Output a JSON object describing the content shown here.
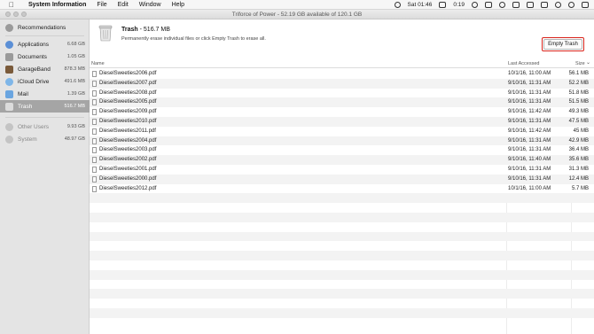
{
  "menubar": {
    "app_name": "System Information",
    "menus": [
      "File",
      "Edit",
      "Window",
      "Help"
    ],
    "clock": "Sat 01:46",
    "battery_time": "0:19"
  },
  "window": {
    "title": "Triforce of Power - 52.19 GB available of 120.1 GB"
  },
  "sidebar": {
    "recommendations": "Recommendations",
    "items": [
      {
        "label": "Applications",
        "size": "6.68 GB",
        "color": "#5b8fd6"
      },
      {
        "label": "Documents",
        "size": "1.05 GB",
        "color": "#9a9a9a"
      },
      {
        "label": "GarageBand",
        "size": "878.3 MB",
        "color": "#7a5a3a"
      },
      {
        "label": "iCloud Drive",
        "size": "491.6 MB",
        "color": "#7fb6e8"
      },
      {
        "label": "Mail",
        "size": "1.39 GB",
        "color": "#6aa5e0"
      },
      {
        "label": "Trash",
        "size": "516.7 MB",
        "color": "#8a8a8a"
      }
    ],
    "other": [
      {
        "label": "Other Users",
        "size": "9.93 GB"
      },
      {
        "label": "System",
        "size": "48.97 GB"
      }
    ]
  },
  "header": {
    "title": "Trash",
    "size": " - 516.7 MB",
    "description": "Permanently erase individual files or click Empty Trash to erase all.",
    "empty_button": "Empty Trash"
  },
  "columns": {
    "name": "Name",
    "last_accessed": "Last Accessed",
    "size": "Size"
  },
  "files": [
    {
      "name": "DieselSweeties2006.pdf",
      "date": "10/1/16, 11:00 AM",
      "size": "56.1 MB"
    },
    {
      "name": "DieselSweeties2007.pdf",
      "date": "9/10/16, 11:31 AM",
      "size": "52.2 MB"
    },
    {
      "name": "DieselSweeties2008.pdf",
      "date": "9/10/16, 11:31 AM",
      "size": "51.8 MB"
    },
    {
      "name": "DieselSweeties2005.pdf",
      "date": "9/10/16, 11:31 AM",
      "size": "51.5 MB"
    },
    {
      "name": "DieselSweeties2009.pdf",
      "date": "9/10/16, 11:42 AM",
      "size": "49.3 MB"
    },
    {
      "name": "DieselSweeties2010.pdf",
      "date": "9/10/16, 11:31 AM",
      "size": "47.5 MB"
    },
    {
      "name": "DieselSweeties2011.pdf",
      "date": "9/10/16, 11:42 AM",
      "size": "45 MB"
    },
    {
      "name": "DieselSweeties2004.pdf",
      "date": "9/10/16, 11:31 AM",
      "size": "42.9 MB"
    },
    {
      "name": "DieselSweeties2003.pdf",
      "date": "9/10/16, 11:31 AM",
      "size": "36.4 MB"
    },
    {
      "name": "DieselSweeties2002.pdf",
      "date": "9/10/16, 11:40 AM",
      "size": "35.6 MB"
    },
    {
      "name": "DieselSweeties2001.pdf",
      "date": "9/10/16, 11:31 AM",
      "size": "31.3 MB"
    },
    {
      "name": "DieselSweeties2000.pdf",
      "date": "9/10/16, 11:31 AM",
      "size": "12.4 MB"
    },
    {
      "name": "DieselSweeties2012.pdf",
      "date": "10/1/16, 11:00 AM",
      "size": "5.7 MB"
    }
  ]
}
